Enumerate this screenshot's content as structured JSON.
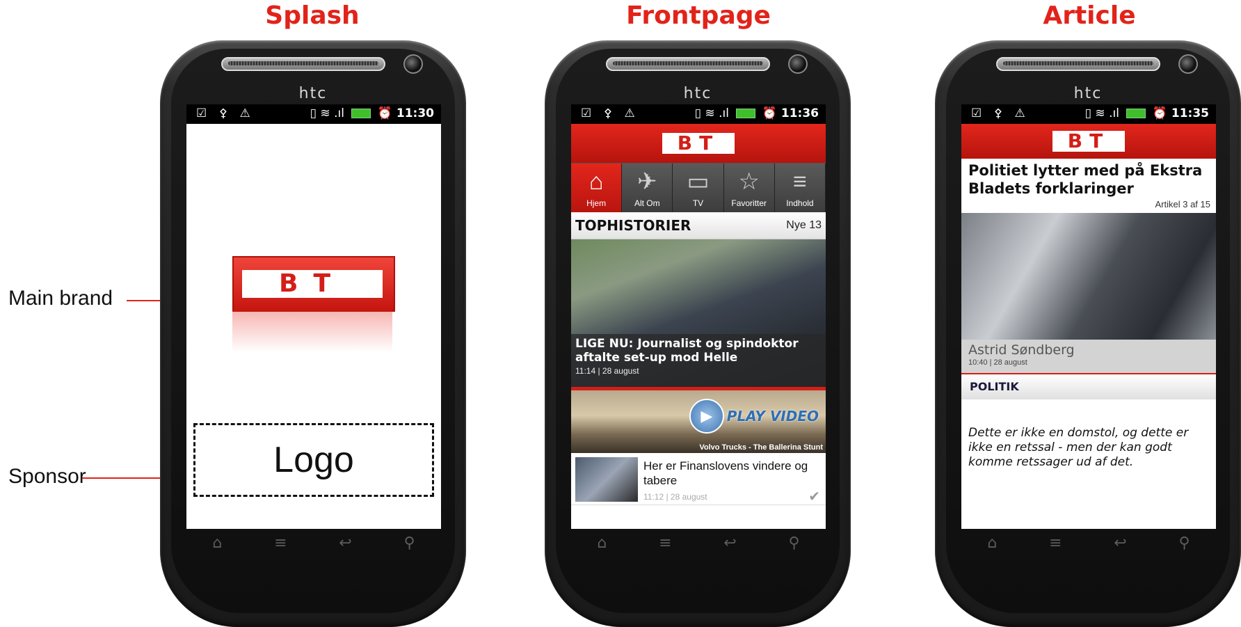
{
  "headings": {
    "splash": "Splash",
    "frontpage": "Frontpage",
    "article": "Article"
  },
  "annotations": {
    "main_brand": "Main brand",
    "sponsor": "Sponsor"
  },
  "phone": {
    "brand": "htc",
    "nav_keys": [
      "⌂",
      "≡",
      "↩",
      "⚲"
    ]
  },
  "splash": {
    "status_icons": "☑ ⚴ ⚠",
    "status_right_icons": "▯ ≋ .ıl",
    "clock": "11:30",
    "logo_text": "BT",
    "sponsor_placeholder": "Logo"
  },
  "frontpage": {
    "status_icons": "☑ ⚴ ⚠",
    "status_right_icons": "▯ ≋ .ıl",
    "clock": "11:36",
    "logo_text": "BT",
    "tabs": [
      {
        "label": "Hjem",
        "icon": "⌂"
      },
      {
        "label": "Alt Om",
        "icon": "✈"
      },
      {
        "label": "TV",
        "icon": "▭"
      },
      {
        "label": "Favoritter",
        "icon": "☆"
      },
      {
        "label": "Indhold",
        "icon": "≡"
      }
    ],
    "section_title": "TOPHISTORIER",
    "section_count": "Nye 13",
    "hero_title": "LIGE NU: Journalist og spindoktor aftalte set-up mod Helle",
    "hero_meta": "11:14 | 28 august",
    "video_label": "PLAY VIDEO",
    "video_caption": "Volvo Trucks - The Ballerina Stunt",
    "list_title": "Her er Finanslovens vindere og tabere",
    "list_meta": "11:12 | 28 august"
  },
  "article": {
    "status_icons": "☑ ⚴ ⚠",
    "status_right_icons": "▯ ≋ .ıl",
    "clock": "11:35",
    "logo_text": "BT",
    "title": "Politiet lytter med på Ekstra Bladets forklaringer",
    "counter": "Artikel 3 af 15",
    "author": "Astrid Søndberg",
    "meta": "10:40 | 28 august",
    "section": "POLITIK",
    "lead": "Dette er ikke en domstol, og dette er ikke en retssal - men der kan godt komme retssager ud af det."
  },
  "colors": {
    "accent": "#e2231a",
    "bt_red": "#d41e18"
  }
}
